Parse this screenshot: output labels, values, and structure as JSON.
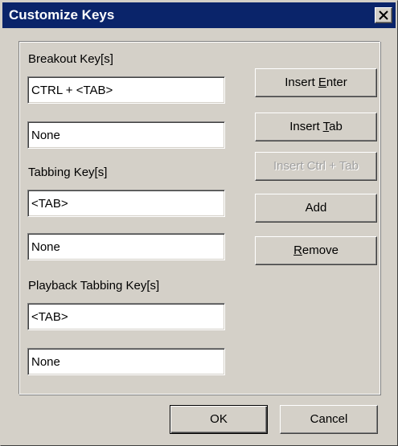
{
  "window": {
    "title": "Customize Keys",
    "close_icon": "close-icon"
  },
  "sections": {
    "breakout": {
      "label": "Breakout Key[s]",
      "field1": "CTRL + <TAB>",
      "field2": "None"
    },
    "tabbing": {
      "label": "Tabbing Key[s]",
      "field1": "<TAB>",
      "field2": "None"
    },
    "playback": {
      "label": "Playback Tabbing Key[s]",
      "field1": "<TAB>",
      "field2": "None"
    }
  },
  "buttons": {
    "insert_enter": {
      "pre": "Insert ",
      "accel": "E",
      "post": "nter"
    },
    "insert_tab": {
      "pre": "Insert ",
      "accel": "T",
      "post": "ab"
    },
    "insert_ctrl_tab": {
      "label": "Insert Ctrl + Tab",
      "enabled": false
    },
    "add": {
      "label": "Add"
    },
    "remove": {
      "pre": "",
      "accel": "R",
      "post": "emove"
    },
    "ok": {
      "label": "OK"
    },
    "cancel": {
      "label": "Cancel"
    }
  },
  "colors": {
    "titlebar": "#0a246a",
    "face": "#d4d0c8",
    "disabled_text": "#a0a0a0"
  }
}
